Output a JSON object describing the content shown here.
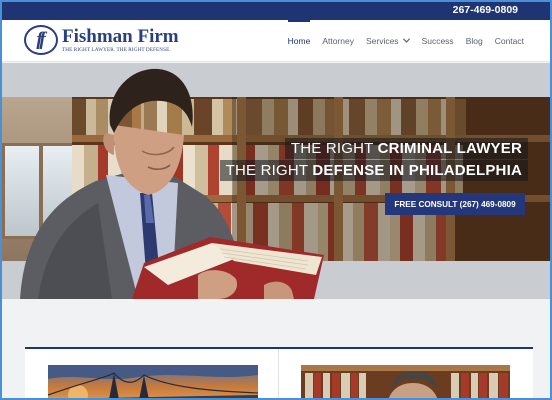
{
  "topbar": {
    "phone": "267-469-0809"
  },
  "brand": {
    "mark": "ff",
    "name": "Fishman Firm",
    "tagline": "THE RIGHT LAWYER. THE RIGHT DEFENSE."
  },
  "nav": {
    "items": [
      {
        "label": "Home",
        "active": true
      },
      {
        "label": "Attorney"
      },
      {
        "label": "Services",
        "has_dropdown": true
      },
      {
        "label": "Success"
      },
      {
        "label": "Blog"
      },
      {
        "label": "Contact"
      }
    ],
    "dropdown_icon": "chevron-down-icon"
  },
  "hero": {
    "line1_pre": "THE RIGHT ",
    "line1_bold": "CRIMINAL LAWYER",
    "line2_pre": "THE RIGHT ",
    "line2_bold": "DEFENSE IN PHILADELPHIA",
    "cta_label": "FREE CONSULT (267) 469-0809"
  },
  "colors": {
    "navy": "#1f3573",
    "cta": "#24377a",
    "frame": "#4a90d6"
  }
}
